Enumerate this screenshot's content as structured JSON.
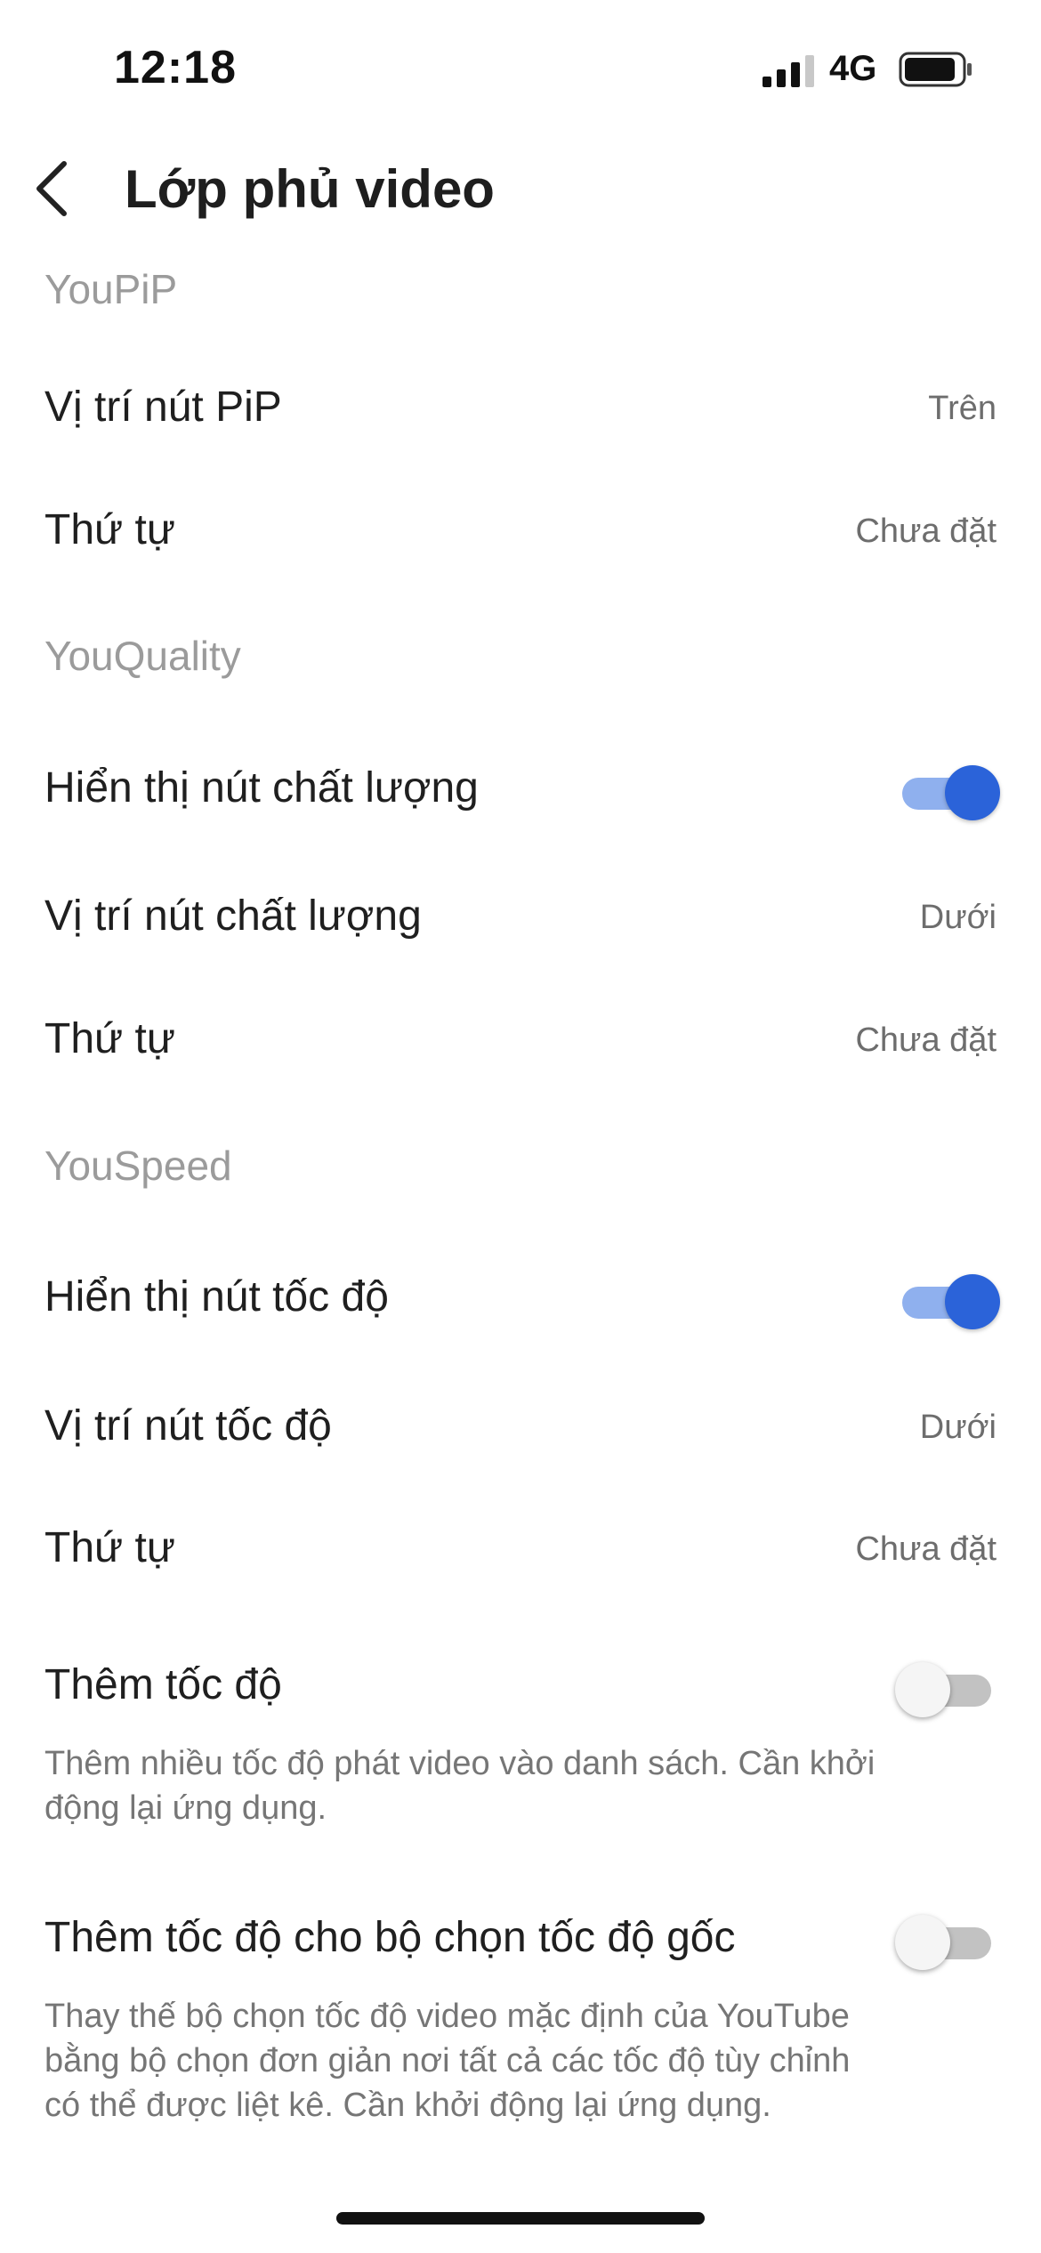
{
  "status_bar": {
    "time": "12:18",
    "network": "4G",
    "signal_icon": "cellular-signal-icon",
    "battery_icon": "battery-icon"
  },
  "header": {
    "back_icon": "chevron-left-icon",
    "title": "Lớp phủ video"
  },
  "sections": {
    "youpip": {
      "header": "YouPiP",
      "pip_position": {
        "label": "Vị trí nút PiP",
        "value": "Trên"
      },
      "order": {
        "label": "Thứ tự",
        "value": "Chưa đặt"
      }
    },
    "youquality": {
      "header": "YouQuality",
      "show_quality_button": {
        "label": "Hiển thị nút chất lượng",
        "toggle": true
      },
      "quality_position": {
        "label": "Vị trí nút chất lượng",
        "value": "Dưới"
      },
      "order": {
        "label": "Thứ tự",
        "value": "Chưa đặt"
      }
    },
    "youspeed": {
      "header": "YouSpeed",
      "show_speed_button": {
        "label": "Hiển thị nút tốc độ",
        "toggle": true
      },
      "speed_position": {
        "label": "Vị trí nút tốc độ",
        "value": "Dưới"
      },
      "order": {
        "label": "Thứ tự",
        "value": "Chưa đặt"
      },
      "add_speeds": {
        "label": "Thêm tốc độ",
        "toggle": false,
        "description": "Thêm nhiều tốc độ phát video vào danh sách. Cần khởi động lại ứng dụng."
      },
      "add_speeds_native": {
        "label": "Thêm tốc độ cho bộ chọn tốc độ gốc",
        "toggle": false,
        "description": "Thay thế bộ chọn tốc độ video mặc định của YouTube bằng bộ chọn đơn giản nơi tất cả các tốc độ tùy chỉnh có thể được liệt kê. Cần khởi động lại ứng dụng."
      }
    }
  },
  "colors": {
    "toggle_on_knob": "#2b63d9",
    "toggle_on_track": "#8fb0ee",
    "toggle_off_track": "#c2c2c2",
    "section_header": "#9b9b9b"
  }
}
